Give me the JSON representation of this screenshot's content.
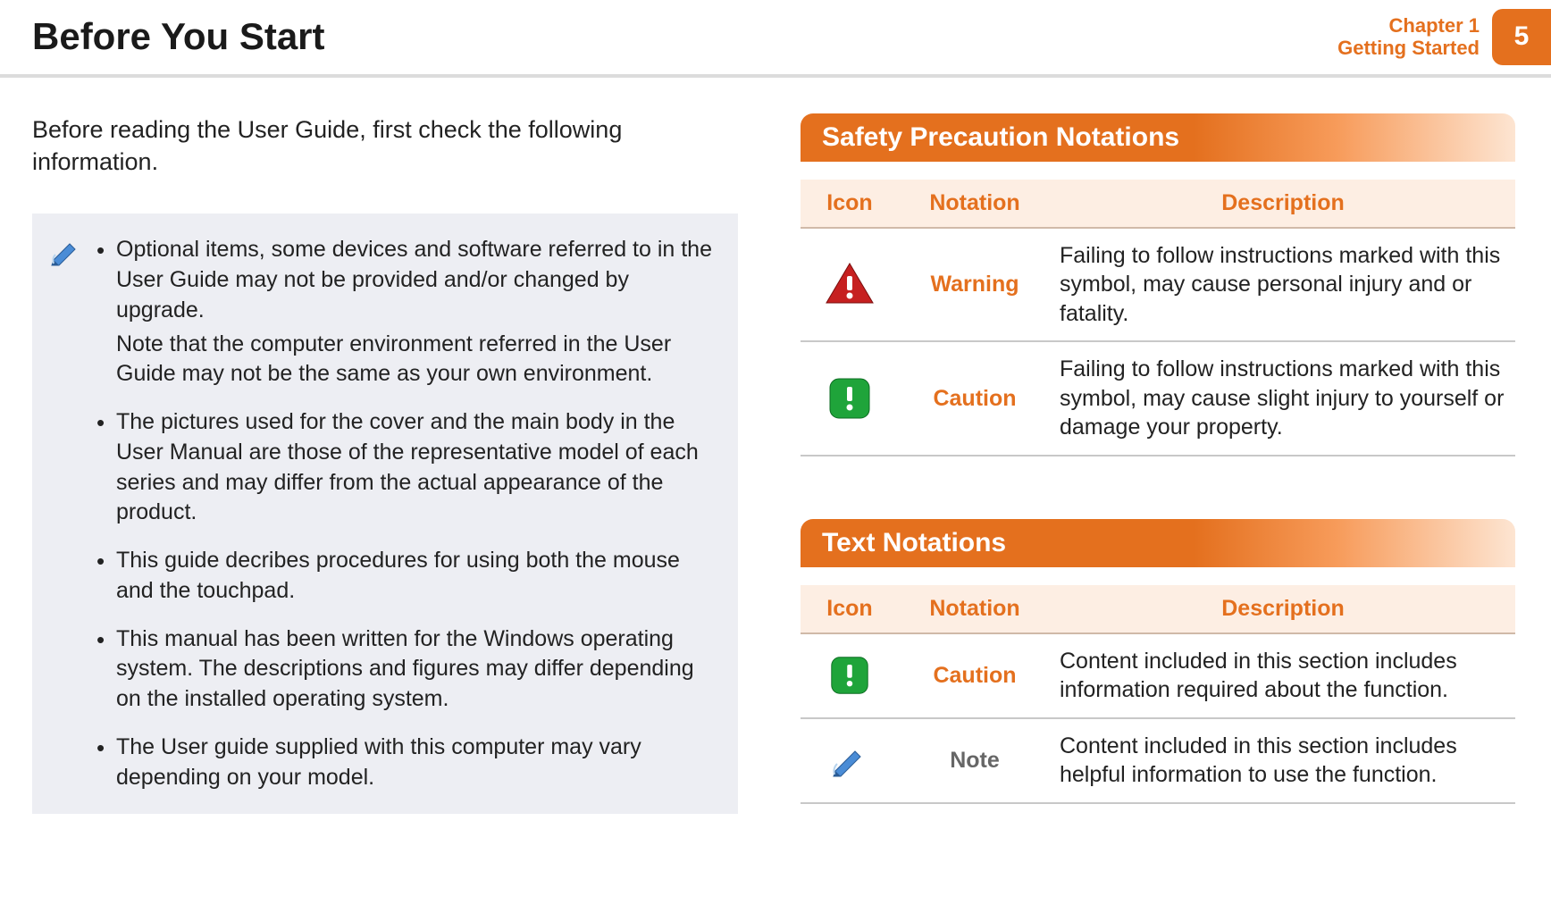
{
  "header": {
    "title": "Before You Start",
    "chapter_line1": "Chapter 1",
    "chapter_line2": "Getting Started",
    "page_number": "5"
  },
  "left": {
    "intro": "Before reading the User Guide, first check the following information.",
    "bullets": {
      "b1_main": "Optional items, some devices and software referred to in the User Guide may not be provided and/or changed by upgrade.",
      "b1_sub": "Note that the computer environment referred in the User Guide may not be the same as your own environment.",
      "b2": "The pictures used for the cover and the main body in the User Manual are those of the representative model of each series and may differ from the actual appearance of the product.",
      "b3": "This guide decribes procedures for using both the mouse and the touchpad.",
      "b4": "This manual has been written for the Windows operating system. The descriptions and figures may differ depending on the installed operating system.",
      "b5": "The User guide supplied with this computer may vary depending on your model."
    }
  },
  "right": {
    "safety_heading": "Safety Precaution Notations",
    "text_heading": "Text Notations",
    "table_headers": {
      "icon": "Icon",
      "notation": "Notation",
      "description": "Description"
    },
    "safety_rows": {
      "warning_label": "Warning",
      "warning_desc": "Failing to follow instructions marked with this symbol, may cause personal injury and or fatality.",
      "caution_label": "Caution",
      "caution_desc": "Failing to follow instructions marked with this symbol, may cause slight injury to yourself or damage your property."
    },
    "text_rows": {
      "caution_label": "Caution",
      "caution_desc": "Content included in this section includes information required about the function.",
      "note_label": "Note",
      "note_desc": "Content included in this section includes helpful information to use the function."
    }
  }
}
